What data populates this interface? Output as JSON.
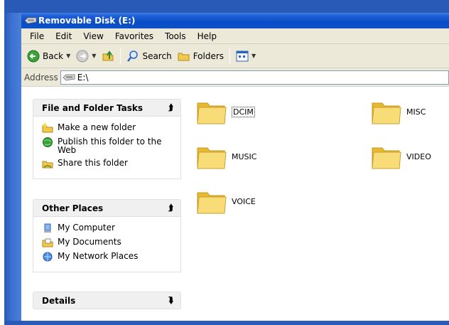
{
  "window": {
    "title": "Removable Disk (E:)"
  },
  "menu": [
    "File",
    "Edit",
    "View",
    "Favorites",
    "Tools",
    "Help"
  ],
  "toolbar": {
    "back": "Back",
    "search": "Search",
    "folders": "Folders"
  },
  "address": {
    "label": "Address",
    "value": "E:\\"
  },
  "taskpane": {
    "file_tasks": {
      "title": "File and Folder Tasks",
      "items": [
        "Make a new folder",
        "Publish this folder to the Web",
        "Share this folder"
      ]
    },
    "other_places": {
      "title": "Other Places",
      "items": [
        "My Computer",
        "My Documents",
        "My Network Places"
      ]
    },
    "details": {
      "title": "Details"
    }
  },
  "folders": [
    "DCIM",
    "MISC",
    "MUSIC",
    "VIDEO",
    "VOICE"
  ],
  "colors": {
    "title_bar": "#0a4cc8",
    "task_pane": "#ffffff",
    "folder": "#f5d66b"
  }
}
